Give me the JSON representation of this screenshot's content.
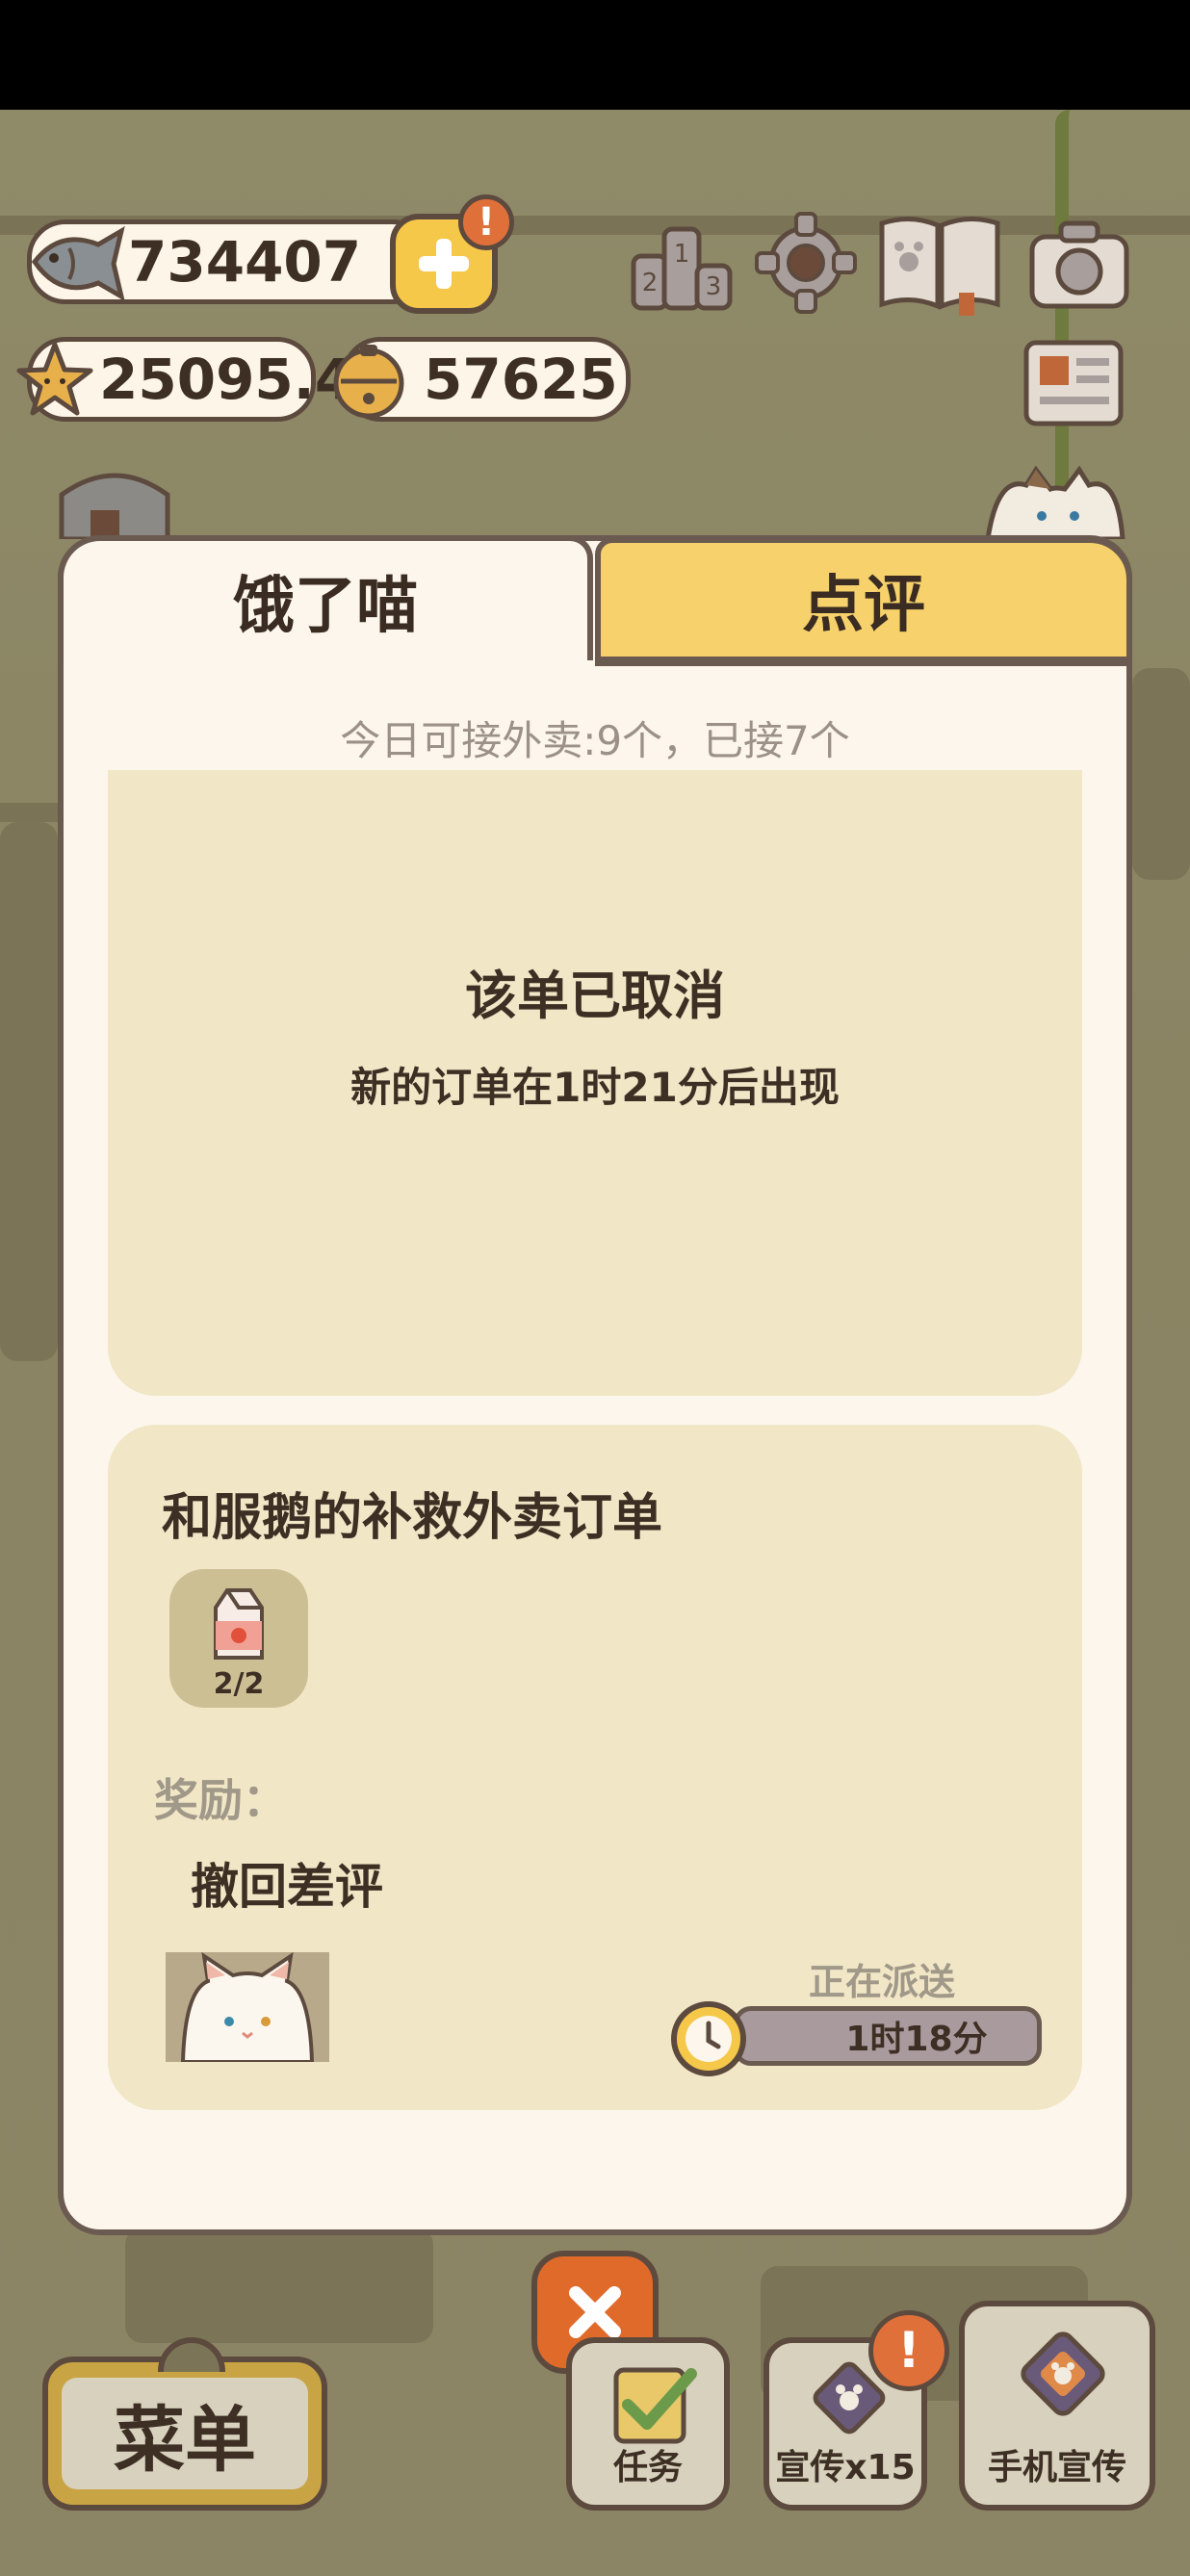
{
  "currencies": {
    "fish": "734407",
    "star": "25095.4",
    "bell": "57625"
  },
  "icons": {
    "fish": "fish-icon",
    "star": "star-icon",
    "bell": "bell-icon",
    "plus": "plus-icon",
    "ranking": "ranking-icon",
    "settings": "gear-icon",
    "book": "paw-book-icon",
    "camera": "camera-icon",
    "newspaper": "newspaper-icon",
    "close": "close-icon",
    "milk": "milk-carton-icon",
    "clock": "clock-icon"
  },
  "badges": {
    "plus_alert": "!",
    "promo_alert": "!"
  },
  "tabs": {
    "hungry_meow": "饿了喵",
    "review": "点评"
  },
  "quota_text": "今日可接外卖:9个，已接7个",
  "cancelled_order": {
    "title": "该单已取消",
    "subtitle": "新的订单在1时21分后出现"
  },
  "rescue_order": {
    "title": "和服鹅的补救外卖订单",
    "item_count": "2/2",
    "reward_label": "奖励：",
    "reward_text": "撤回差评",
    "status": "正在派送",
    "timer": "1时18分"
  },
  "bottom_bar": {
    "menu": "菜单",
    "task": "任务",
    "promo": "宣传x15",
    "phone_promo": "手机宣传"
  },
  "colors": {
    "panel_bg": "#fdf6ec",
    "card_bg": "#f1e6c6",
    "tab_active_bg": "#f7d16b",
    "border": "#6b5a50",
    "accent_orange": "#e06a2a",
    "gold": "#f5c84a"
  }
}
